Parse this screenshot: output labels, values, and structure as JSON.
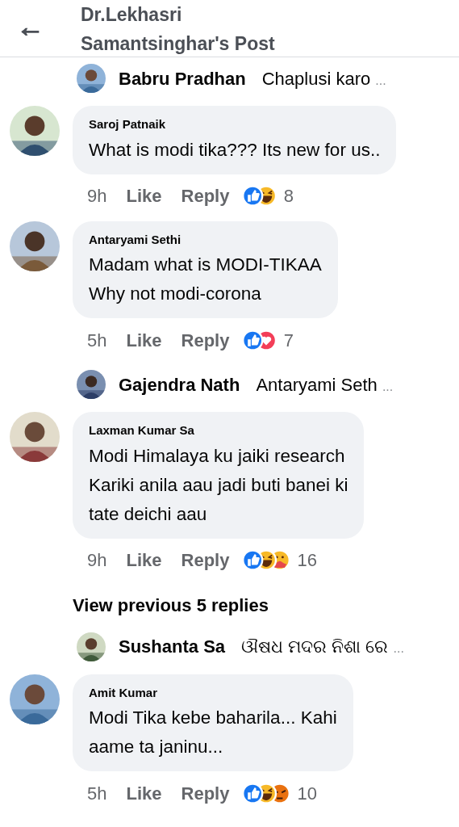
{
  "header": {
    "back_icon": "←",
    "title": "Dr.Lekhasri Samantsinghar's Post"
  },
  "items": [
    {
      "kind": "preview",
      "name": "Babru Pradhan",
      "text": "Chaplusi karo",
      "ellipsis": "..."
    },
    {
      "kind": "comment",
      "name": "Saroj Patnaik",
      "lines": [
        "What is modi tika??? Its new for us.."
      ],
      "time": "9h",
      "like": "Like",
      "reply": "Reply",
      "reactions": [
        {
          "kind": "like"
        },
        {
          "kind": "haha"
        }
      ],
      "count": "8"
    },
    {
      "kind": "comment",
      "name": "Antaryami Sethi",
      "lines": [
        "Madam what is MODI-TIKAA",
        "Why not modi-corona"
      ],
      "time": "5h",
      "like": "Like",
      "reply": "Reply",
      "reactions": [
        {
          "kind": "like"
        },
        {
          "kind": "love"
        }
      ],
      "count": "7"
    },
    {
      "kind": "preview",
      "name": "Gajendra Nath",
      "text": "Antaryami Seth",
      "ellipsis": "..."
    },
    {
      "kind": "comment",
      "name": "Laxman Kumar Sa",
      "lines": [
        "Modi Himalaya ku jaiki research",
        "Kariki anila aau jadi buti banei ki",
        "tate deichi aau"
      ],
      "time": "9h",
      "like": "Like",
      "reply": "Reply",
      "reactions": [
        {
          "kind": "like"
        },
        {
          "kind": "haha"
        },
        {
          "kind": "care"
        }
      ],
      "count": "16"
    },
    {
      "kind": "more",
      "text": "View previous 5 replies"
    },
    {
      "kind": "preview",
      "name": "Sushanta Sa",
      "text": "ଔଷଧ ମଦର ନିଶା ରେ",
      "ellipsis": "..."
    },
    {
      "kind": "comment",
      "name": "Amit Kumar",
      "lines": [
        "Modi Tika kebe baharila... Kahi",
        "aame ta janinu..."
      ],
      "time": "5h",
      "like": "Like",
      "reply": "Reply",
      "reactions": [
        {
          "kind": "like"
        },
        {
          "kind": "haha"
        },
        {
          "kind": "angry"
        }
      ],
      "count": "10"
    }
  ]
}
